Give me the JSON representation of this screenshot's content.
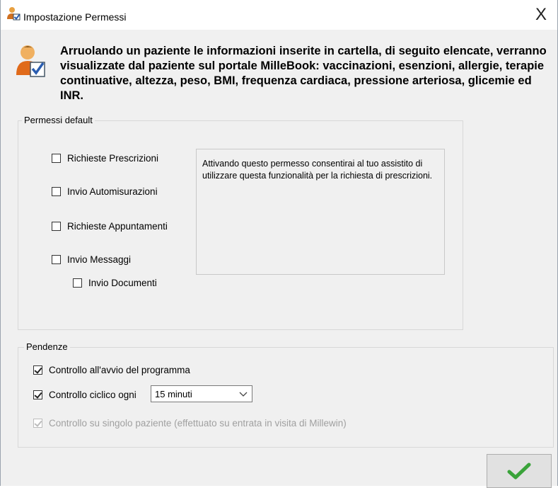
{
  "window": {
    "title": "Impostazione Permessi",
    "close_label": "X"
  },
  "info": {
    "text": "Arruolando un paziente le informazioni inserite in cartella, di seguito elencate, verranno visualizzate dal paziente sul portale MilleBook: vaccinazioni, esenzioni, allergie, terapie continuative, altezza, peso, BMI, frequenza cardiaca, pressione arteriosa, glicemie ed INR."
  },
  "permessi": {
    "legend": "Permessi default",
    "items": [
      {
        "label": "Richieste Prescrizioni",
        "checked": false
      },
      {
        "label": "Invio Automisurazioni",
        "checked": false
      },
      {
        "label": "Richieste Appuntamenti",
        "checked": false
      },
      {
        "label": "Invio Messaggi",
        "checked": false
      },
      {
        "label": "Invio Documenti",
        "checked": false
      }
    ],
    "description": "Attivando questo permesso consentirai al tuo assistito di utilizzare questa funzionalità per la richiesta di prescrizioni."
  },
  "pendenze": {
    "legend": "Pendenze",
    "items": [
      {
        "label": "Controllo all'avvio del programma",
        "checked": true,
        "enabled": true
      },
      {
        "label": "Controllo ciclico ogni",
        "checked": true,
        "enabled": true
      },
      {
        "label": "Controllo su singolo paziente (effettuato su entrata in visita di Millewin)",
        "checked": true,
        "enabled": false
      }
    ],
    "interval_value": "15 minuti"
  },
  "icons": {
    "title": "user-check-icon",
    "info": "user-check-icon",
    "ok": "checkmark-icon",
    "dropdown": "chevron-down-icon"
  },
  "colors": {
    "ok_check": "#3aa33a",
    "window_bg": "#f0f0f0"
  }
}
